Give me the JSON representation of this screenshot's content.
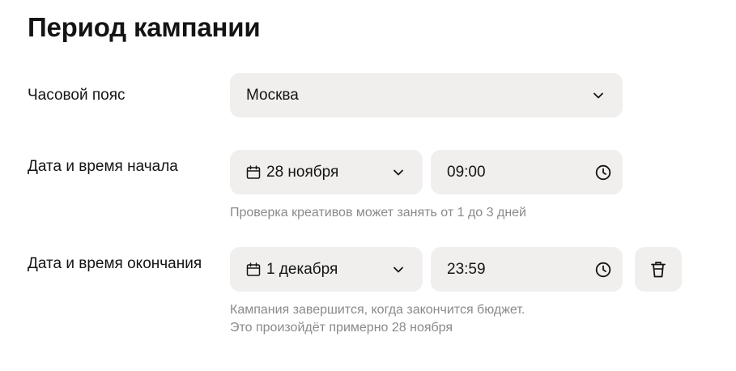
{
  "section_title": "Период кампании",
  "timezone": {
    "label": "Часовой пояс",
    "value": "Москва"
  },
  "start": {
    "label": "Дата и время начала",
    "date": "28 ноября",
    "time": "09:00",
    "hint": "Проверка креативов может занять от 1 до 3 дней"
  },
  "end": {
    "label": "Дата и время окончания",
    "date": "1 декабря",
    "time": "23:59",
    "hint_line1": "Кампания завершится, когда закончится бюджет.",
    "hint_line2": "Это произойдёт примерно 28 ноября"
  },
  "icons": {
    "chevron": "chevron-down-icon",
    "calendar": "calendar-icon",
    "clock": "clock-icon",
    "trash": "trash-icon"
  }
}
